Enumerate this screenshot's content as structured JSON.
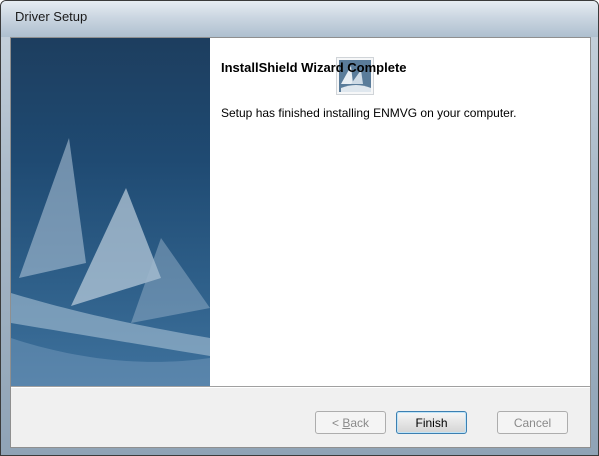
{
  "window": {
    "title": "Driver Setup"
  },
  "wizard": {
    "logo_icon": "installshield-logo-icon",
    "heading": "InstallShield Wizard Complete",
    "message": "Setup has finished installing ENMVG on your computer."
  },
  "buttons": {
    "back_mnemonic": "B",
    "back_rest": "ack",
    "back_prefix": "< ",
    "finish": "Finish",
    "cancel": "Cancel"
  },
  "colors": {
    "side_panel": "#1f4a72",
    "default_button_border": "#3c7fb1"
  }
}
